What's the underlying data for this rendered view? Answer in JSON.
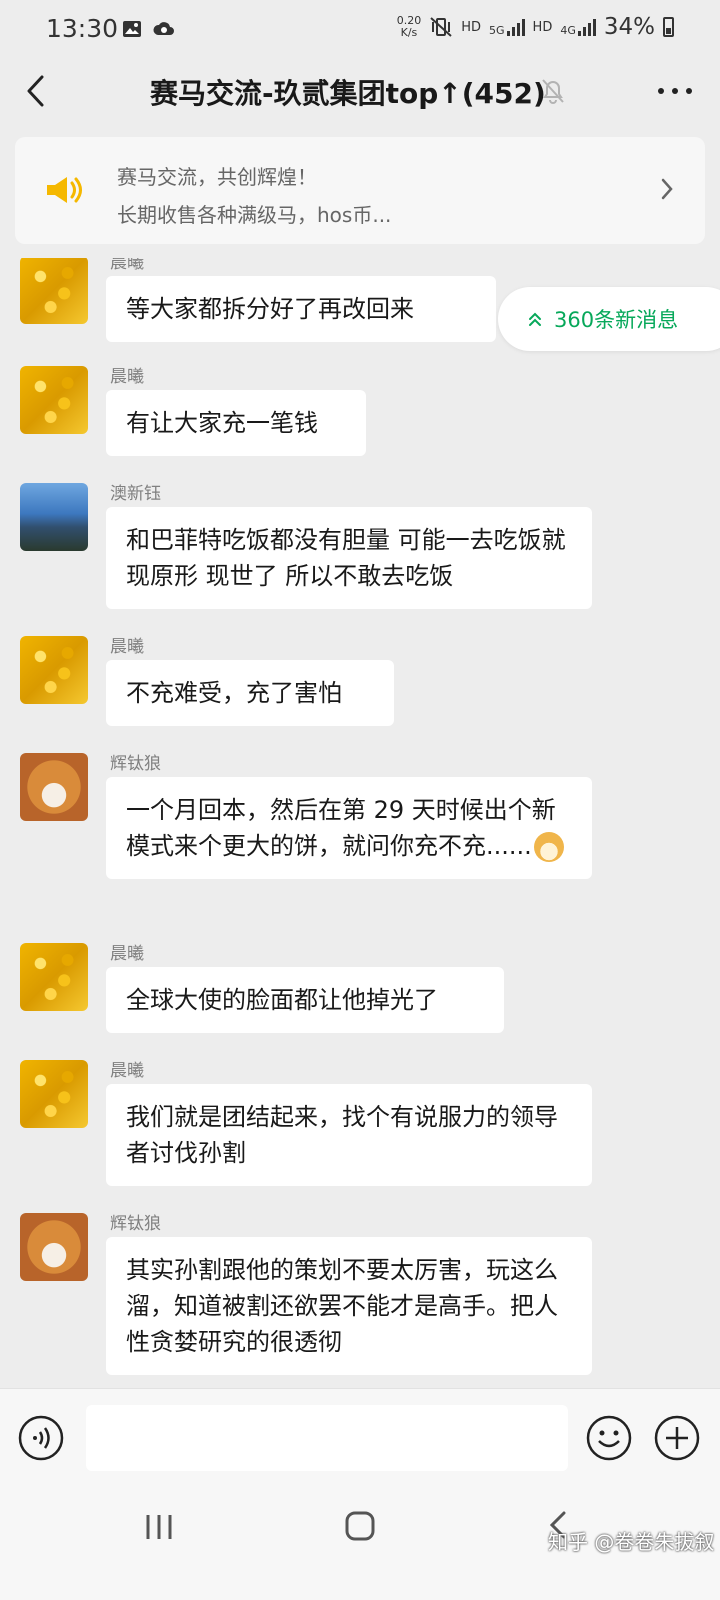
{
  "status_bar": {
    "time": "13:30",
    "net_speed": "0.20",
    "net_speed_unit": "K/s",
    "hd1": "HD",
    "net_5g": "5G",
    "hd2": "HD",
    "net_4g": "4G",
    "battery": "34%"
  },
  "header": {
    "title": "赛马交流-玖贰集团top↑(452)"
  },
  "notice": {
    "line1": "赛马交流，共创辉煌！",
    "line2": "长期收售各种满级马，hos币..."
  },
  "new_messages": {
    "label": "360条新消息"
  },
  "messages": [
    {
      "sender": "晨曦",
      "text": "等大家都拆分好了再改回来"
    },
    {
      "sender": "晨曦",
      "text": "有让大家充一笔钱"
    },
    {
      "sender": "澳新钰",
      "text": "和巴菲特吃饭都没有胆量 可能一去吃饭就现原形 现世了  所以不敢去吃饭"
    },
    {
      "sender": "晨曦",
      "text": "不充难受，充了害怕"
    },
    {
      "sender": "辉钛狼",
      "text": "一个月回本，然后在第 29 天时候出个新模式来个更大的饼，就问你充不充......"
    },
    {
      "sender": "晨曦",
      "text": "全球大使的脸面都让他掉光了"
    },
    {
      "sender": "晨曦",
      "text": "我们就是团结起来，找个有说服力的领导者讨伐孙割"
    },
    {
      "sender": "辉钛狼",
      "text": "其实孙割跟他的策划不要太厉害，玩这么溜，知道被割还欲罢不能才是高手。把人性贪婪研究的很透彻"
    }
  ],
  "input": {
    "value": ""
  },
  "watermark": "知乎 @卷卷朱拔叙"
}
